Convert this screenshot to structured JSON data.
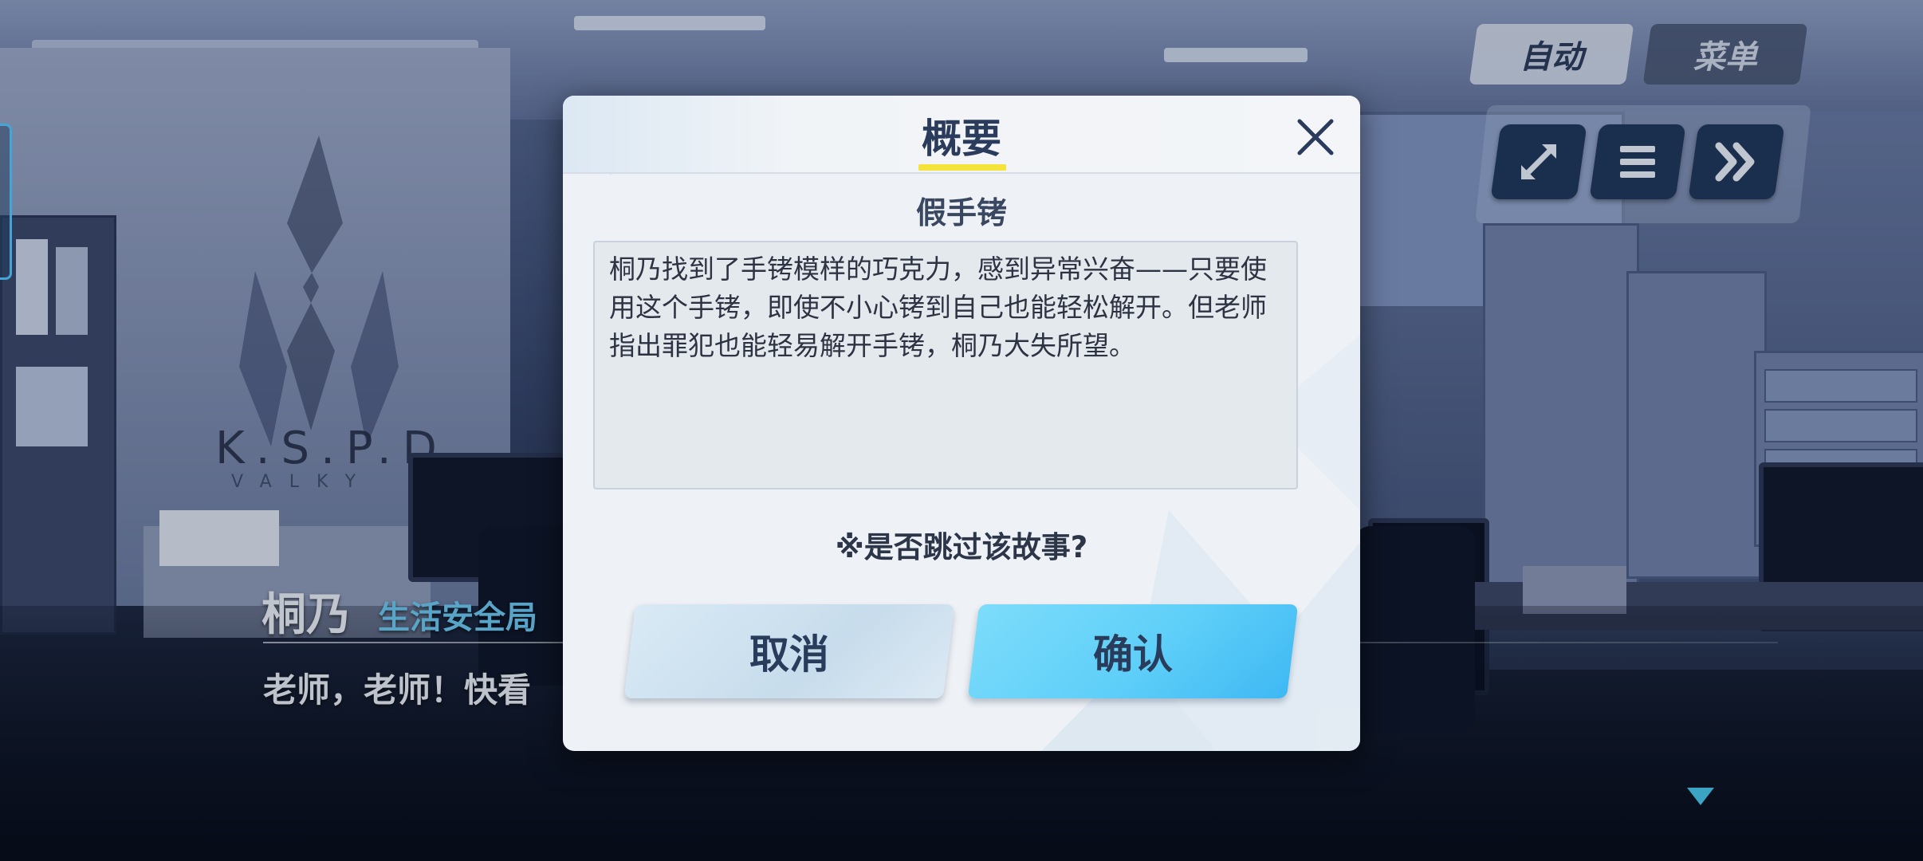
{
  "background": {
    "logo_text": "K.S.P.D",
    "logo_subtext": "VALKY"
  },
  "dialogue": {
    "speaker_name": "桐乃",
    "speaker_affiliation": "生活安全局",
    "text": "老师，老师！快看"
  },
  "top_controls": {
    "auto_label": "自动",
    "menu_label": "菜单",
    "buttons": [
      {
        "icon": "fullscreen-icon"
      },
      {
        "icon": "log-icon"
      },
      {
        "icon": "fast-forward-icon"
      }
    ]
  },
  "modal": {
    "title": "概要",
    "story_title": "假手铐",
    "summary": "桐乃找到了手铐模样的巧克力，感到异常兴奋——只要使用这个手铐，即使不小心铐到自己也能轻松解开。但老师指出罪犯也能轻易解开手铐，桐乃大失所望。",
    "question": "※是否跳过该故事?",
    "cancel_label": "取消",
    "confirm_label": "确认"
  },
  "colors": {
    "accent_cyan": "#5ecff8",
    "title_underline": "#f3e33a",
    "text_dark": "#2a3b5c",
    "affiliation": "#6cc6ee"
  }
}
